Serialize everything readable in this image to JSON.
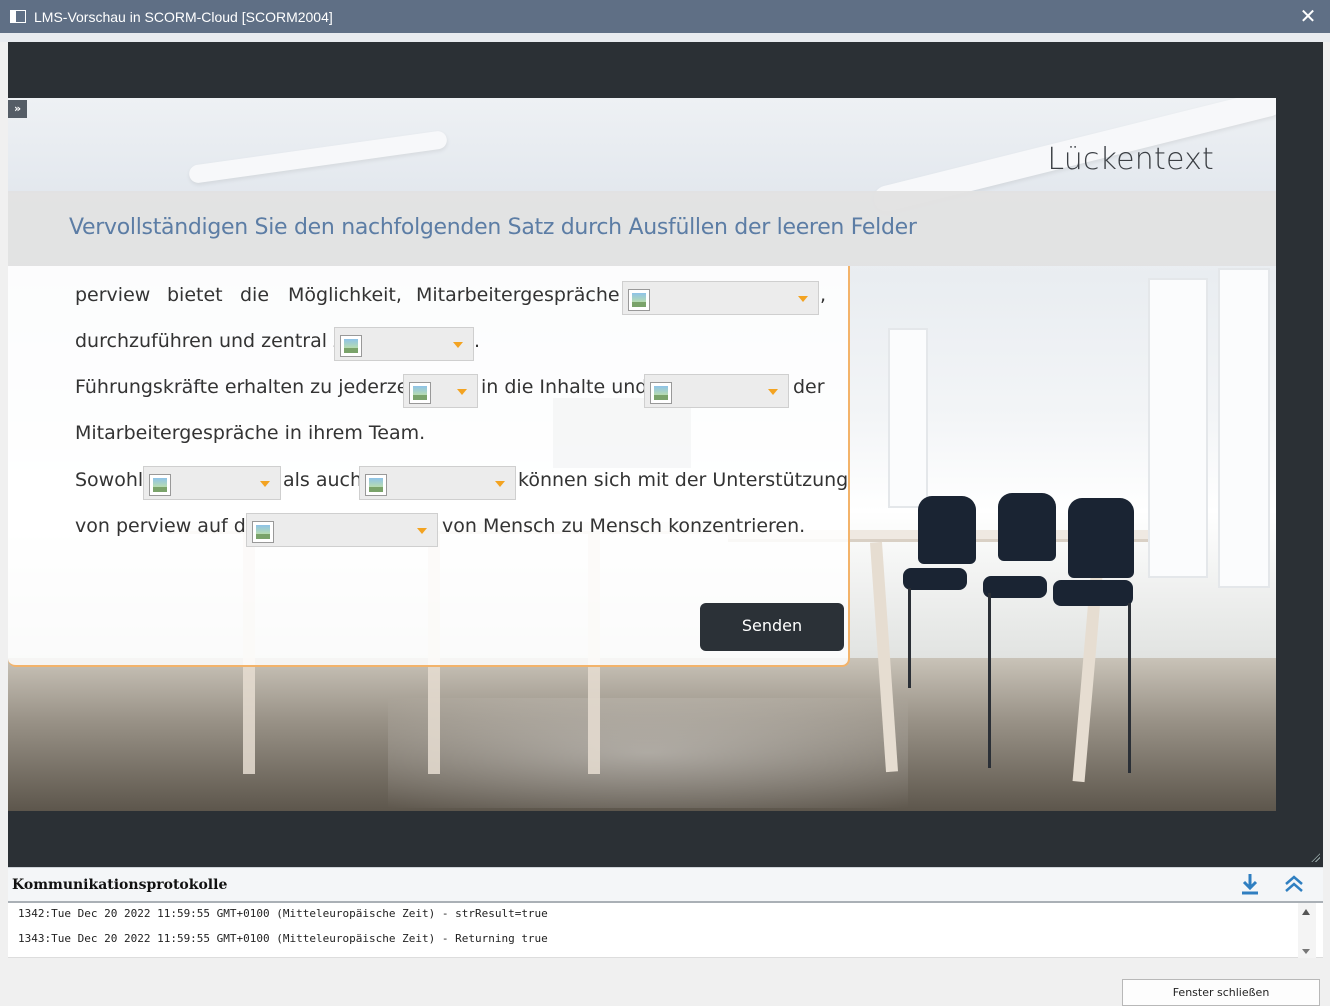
{
  "window": {
    "title": "LMS-Vorschau in SCORM-Cloud [SCORM2004]",
    "close_glyph": "✕"
  },
  "slide": {
    "nav_toggle": "»",
    "title": "Lückentext",
    "instruction": "Vervollständigen Sie den nachfolgenden Satz durch Ausfüllen der leeren Felder",
    "text": {
      "w1": "perview",
      "w2": "bietet",
      "w3": "die",
      "w4": "Möglichkeit,",
      "w5": "Mitarbeitergespräche",
      "comma": ",",
      "line2": "durchzuführen und zentral zu",
      "period": ".",
      "line3a": "Führungskräfte erhalten zu jederzeit",
      "line3b": "in die Inhalte und",
      "line3c": "der",
      "line4": "Mitarbeitergespräche in ihrem Team.",
      "line5a": "Sowohl",
      "line5b": "als auch",
      "line5c": "können sich mit der Unterstützung",
      "line6a": "von perview auf das",
      "line6b": "von Mensch zu Mensch konzentrieren."
    },
    "send_button": "Senden",
    "accent_color": "#f3a321",
    "instruction_color": "#5c7da5"
  },
  "log": {
    "title": "Kommunikationsprotokolle",
    "lines": [
      "1342:Tue Dec 20 2022 11:59:55 GMT+0100 (Mitteleuropäische Zeit) - strResult=true",
      "1343:Tue Dec 20 2022 11:59:55 GMT+0100 (Mitteleuropäische Zeit) - Returning true"
    ],
    "icons": [
      "download-icon",
      "collapse-up-icon"
    ]
  },
  "footer": {
    "close_button": "Fenster schließen"
  }
}
